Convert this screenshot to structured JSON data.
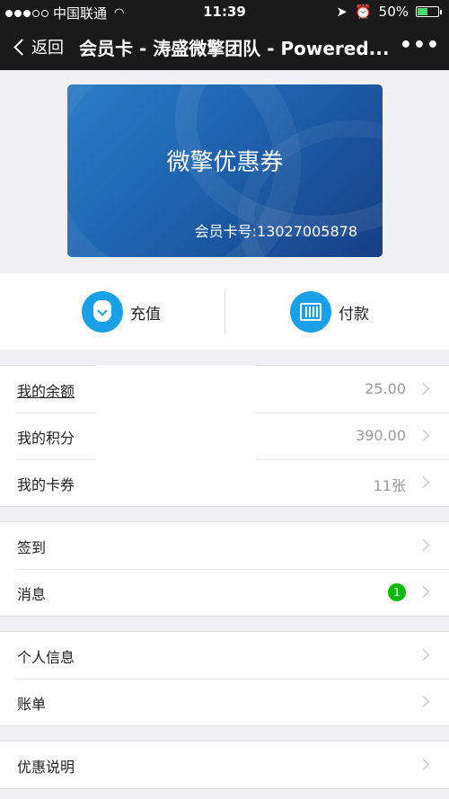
{
  "status_bar": {
    "carrier": "中国联通",
    "time": "11:39",
    "battery": "50%",
    "battery_level": 0.5
  },
  "nav": {
    "back_label": "返回",
    "title": "会员卡 - 涛盛微擎团队 - Powered...",
    "more": "•••"
  },
  "card": {
    "title": "微擎优惠券",
    "number": "会员卡号:13027005878"
  },
  "actions": [
    {
      "label": "充值",
      "icon": "money-bag-icon"
    },
    {
      "label": "付款",
      "icon": "barcode-icon"
    }
  ],
  "groups": [
    [
      {
        "label": "我的余额",
        "value": "25.00"
      },
      {
        "label": "我的积分",
        "value": "390.00"
      },
      {
        "label": "我的卡券",
        "value": "11张"
      }
    ],
    [
      {
        "label": "签到",
        "value": ""
      },
      {
        "label": "消息",
        "badge": "1"
      }
    ],
    [
      {
        "label": "个人信息",
        "value": ""
      },
      {
        "label": "账单",
        "value": ""
      }
    ],
    [
      {
        "label": "优惠说明",
        "value": ""
      }
    ]
  ],
  "colors": {
    "accent": "#1aa0e6",
    "badge": "#09bb07",
    "nav_bg": "#1a1a1a"
  }
}
